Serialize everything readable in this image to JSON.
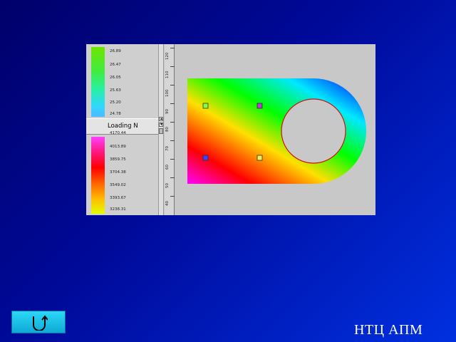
{
  "legend_top": {
    "values": [
      "26.89",
      "26.47",
      "26.05",
      "25.63",
      "25.20",
      "24.78"
    ],
    "colors": [
      "#6fe400",
      "#40ec40",
      "#28f0a0",
      "#30d8ff",
      "#50b8ff"
    ]
  },
  "legend_header": {
    "label": "Loading N"
  },
  "legend_bottom": {
    "values": [
      "4170.44",
      "4013.89",
      "3859.75",
      "3704.38",
      "3549.02",
      "3393.67",
      "3238.31"
    ],
    "colors": [
      "#ff40ff",
      "#ff1a8a",
      "#ff0000",
      "#ff6a00",
      "#ffc000",
      "#e0ff00"
    ]
  },
  "ruler": {
    "labels": [
      "120",
      "110",
      "100",
      "90",
      "80",
      "70",
      "60",
      "50",
      "40"
    ]
  },
  "plot": {
    "gradient_colors": [
      "#ff00ff",
      "#ff0000",
      "#ffe000",
      "#00ff00",
      "#00e8ff",
      "#0000ff"
    ],
    "hole_border_color": "#d01010",
    "markers": [
      "green-marker",
      "purple-marker",
      "blue-marker",
      "yellow-marker"
    ]
  },
  "footer": {
    "back_icon": "return-arrow-icon",
    "brand": "НТЦ АПМ"
  }
}
